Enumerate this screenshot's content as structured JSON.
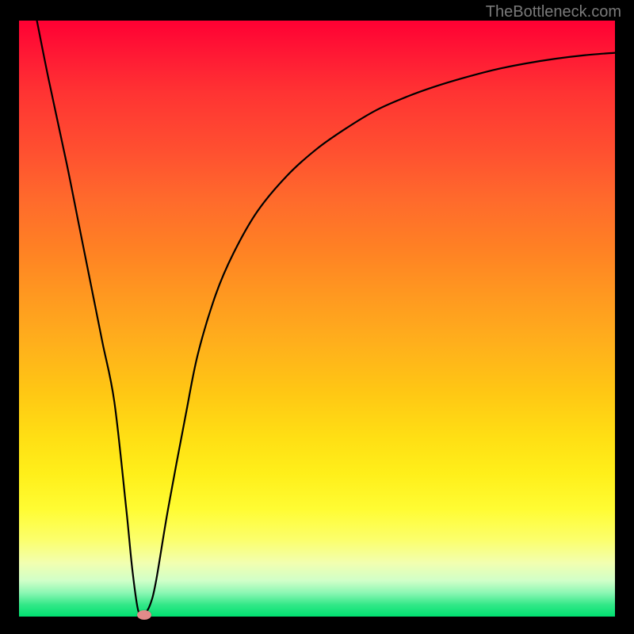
{
  "watermark": "TheBottleneck.com",
  "chart_data": {
    "type": "line",
    "title": "",
    "xlabel": "",
    "ylabel": "",
    "xlim": [
      0,
      100
    ],
    "ylim": [
      0,
      100
    ],
    "grid": false,
    "legend": false,
    "series": [
      {
        "name": "bottleneck-curve",
        "color": "#000000",
        "x": [
          3,
          5,
          8,
          10,
          12,
          14,
          16,
          18,
          19,
          20,
          21,
          22,
          23,
          25,
          28,
          30,
          33,
          36,
          40,
          45,
          50,
          55,
          60,
          65,
          70,
          75,
          80,
          85,
          90,
          95,
          100
        ],
        "y": [
          100,
          90,
          76,
          66,
          56,
          46,
          36,
          18,
          8,
          1,
          0.5,
          2,
          6,
          18,
          34,
          44,
          54,
          61,
          68,
          74,
          78.5,
          82,
          85,
          87.2,
          89,
          90.5,
          91.8,
          92.8,
          93.6,
          94.2,
          94.6
        ]
      }
    ],
    "marker": {
      "x": 21,
      "y": 0.2,
      "color": "#e28a8a"
    },
    "background_gradient": {
      "orientation": "vertical",
      "stops": [
        {
          "pos": 0.0,
          "color": "#ff0033"
        },
        {
          "pos": 0.3,
          "color": "#ff6a2c"
        },
        {
          "pos": 0.62,
          "color": "#ffc614"
        },
        {
          "pos": 0.82,
          "color": "#fffc33"
        },
        {
          "pos": 0.94,
          "color": "#d0ffc8"
        },
        {
          "pos": 1.0,
          "color": "#00e070"
        }
      ]
    }
  }
}
